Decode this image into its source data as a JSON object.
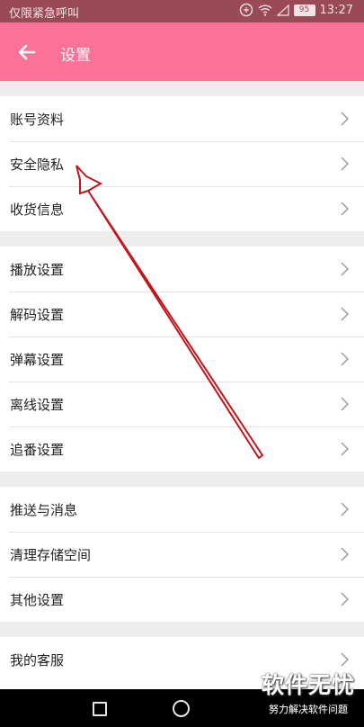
{
  "status_bar": {
    "left_text": "仅限紧急呼叫",
    "battery": "95",
    "time": "13:27"
  },
  "app_bar": {
    "title": "设置"
  },
  "groups": [
    {
      "items": [
        "账号资料",
        "安全隐私",
        "收货信息"
      ]
    },
    {
      "items": [
        "播放设置",
        "解码设置",
        "弹幕设置",
        "离线设置",
        "追番设置"
      ]
    },
    {
      "items": [
        "推送与消息",
        "清理存储空间",
        "其他设置"
      ]
    },
    {
      "items": [
        "我的客服"
      ]
    }
  ],
  "watermark": {
    "main": "软件无忧",
    "sub": "努力解决软件问题"
  },
  "colors": {
    "app_bar": "#fb7299",
    "status_bar": "#9a4a55",
    "annotation": "#c0161c"
  }
}
